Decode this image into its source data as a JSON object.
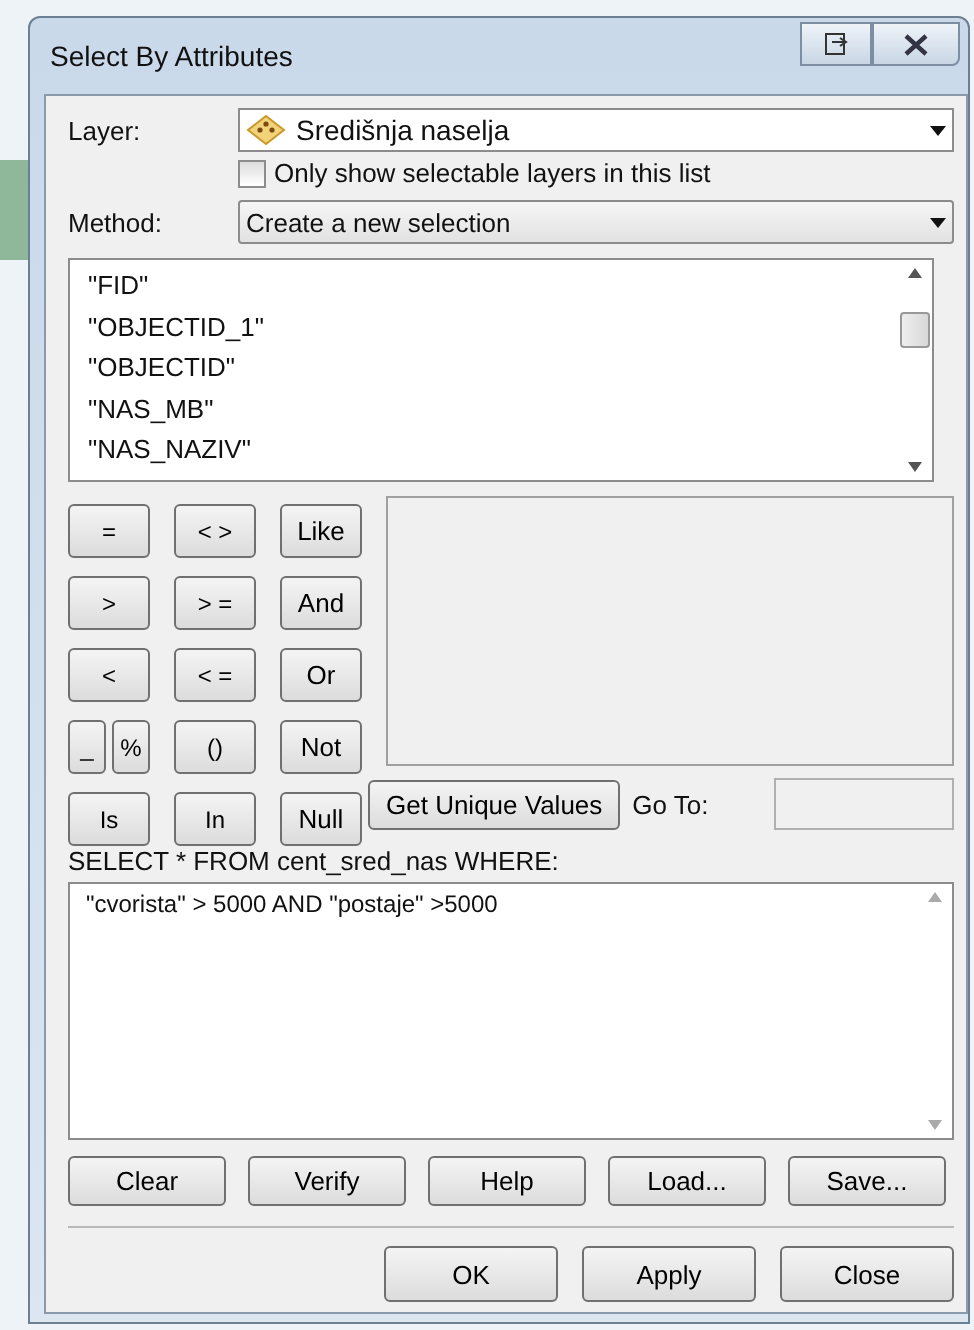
{
  "window": {
    "title": "Select By Attributes"
  },
  "layer": {
    "label": "Layer:",
    "value": "Središnja naselja"
  },
  "selectable_only": {
    "label": "Only show selectable layers in this list",
    "checked": false
  },
  "method": {
    "label": "Method:",
    "value": "Create a new selection"
  },
  "fields": [
    "\"FID\"",
    "\"OBJECTID_1\"",
    "\"OBJECTID\"",
    "\"NAS_MB\"",
    "\"NAS_NAZIV\""
  ],
  "operators": [
    [
      [
        "="
      ],
      [
        "< >"
      ],
      [
        "Like"
      ]
    ],
    [
      [
        ">"
      ],
      [
        "> ="
      ],
      [
        "And"
      ]
    ],
    [
      [
        "<"
      ],
      [
        "< ="
      ],
      [
        "Or"
      ]
    ],
    [
      [
        "_",
        "%"
      ],
      [
        "()"
      ],
      [
        "Not"
      ]
    ],
    [
      [
        "Is"
      ],
      [
        "In"
      ],
      [
        "Null"
      ]
    ]
  ],
  "get_unique_values": "Get Unique Values",
  "go_to": {
    "label": "Go To:"
  },
  "query_label": "SELECT * FROM cent_sred_nas WHERE:",
  "query": "\"cvorista\" > 5000 AND \"postaje\" >5000",
  "actions": [
    "Clear",
    "Verify",
    "Help",
    "Load...",
    "Save..."
  ],
  "buttons": [
    "OK",
    "Apply",
    "Close"
  ]
}
